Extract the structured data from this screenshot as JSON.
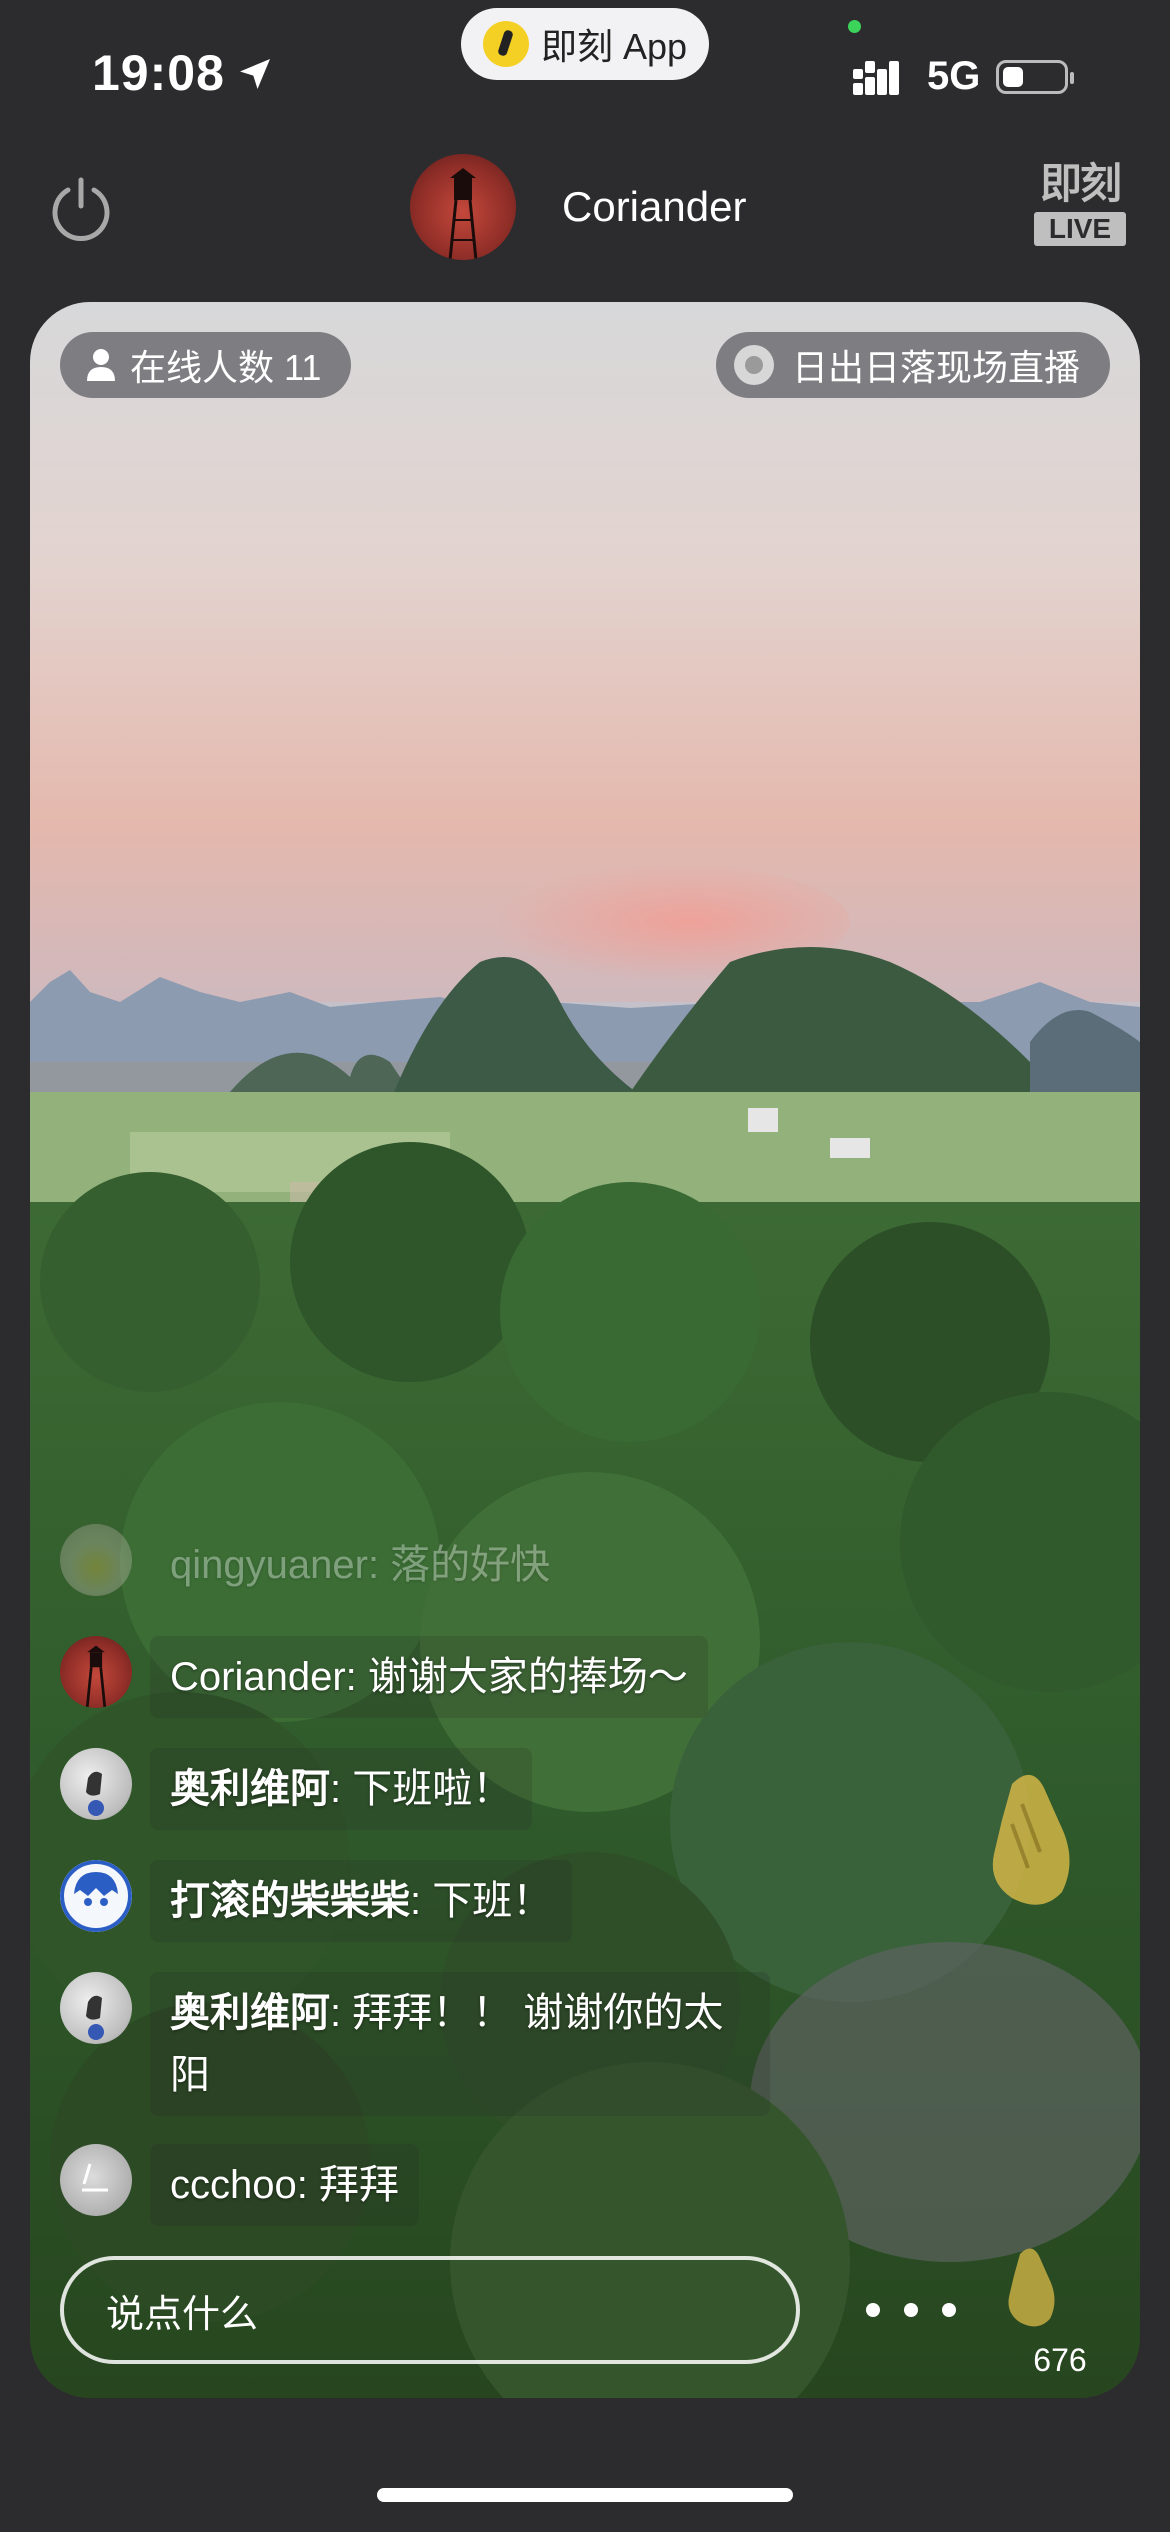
{
  "status_bar": {
    "time": "19:08",
    "network": "5G",
    "battery_level": 0.35
  },
  "app_pill": {
    "label": "即刻 App"
  },
  "header": {
    "host_name": "Coriander",
    "logo_text": "即刻",
    "logo_badge": "LIVE"
  },
  "stream": {
    "online_label": "在线人数 11",
    "topic_label": "日出日落现场直播"
  },
  "comments": [
    {
      "user": "qingyuaner",
      "text": ": 落的好快",
      "faded": true
    },
    {
      "user": "Coriander",
      "text": ": 谢谢大家的捧场～",
      "faded": false
    },
    {
      "user": "奥利维阿",
      "text": ": 下班啦！",
      "faded": false
    },
    {
      "user": "打滚的柴柴柴",
      "text": ": 下班！",
      "faded": false
    },
    {
      "user": "奥利维阿",
      "text": ": 拜拜！！ 谢谢你的太阳",
      "faded": false
    },
    {
      "user": "ccchoo",
      "text": ": 拜拜",
      "faded": false
    }
  ],
  "input": {
    "placeholder": "说点什么"
  },
  "like_count": "676",
  "colors": {
    "background": "#2c2c2e",
    "pill": "#f2f2f4",
    "accent_yellow": "#f4cf24"
  },
  "icons": [
    "location-arrow-icon",
    "signal-icon",
    "battery-icon",
    "power-icon",
    "user-icon",
    "record-dot-icon",
    "more-dots-icon",
    "clap-hands-icon"
  ]
}
